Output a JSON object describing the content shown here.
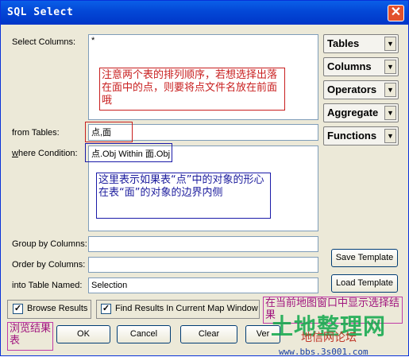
{
  "window": {
    "title": "SQL Select"
  },
  "labels": {
    "select_columns": "Select Columns:",
    "from_tables": "from Tables:",
    "where_condition": "where Condition:",
    "group_by": "Group by Columns:",
    "order_by": "Order by Columns:",
    "into_table": "into Table Named:"
  },
  "fields": {
    "select_columns": "*",
    "from_tables": "点,面",
    "where_condition": "点.Obj Within 面.Obj",
    "group_by": "",
    "order_by": "",
    "into_table": "Selection"
  },
  "side_buttons": [
    "Tables",
    "Columns",
    "Operators",
    "Aggregate",
    "Functions"
  ],
  "buttons": {
    "save_template": "Save Template",
    "load_template": "Load Template",
    "ok": "OK",
    "cancel": "Cancel",
    "clear": "Clear",
    "verify": "Ver"
  },
  "checkboxes": {
    "browse_results": "Browse Results",
    "find_results": "Find Results In Current Map Window"
  },
  "annotations": {
    "order_note": "注意两个表的排列顺序，若想选择出落在面中的点，则要将点文件名放在前面哦",
    "within_note": "这里表示如果表“点”中的对象的形心在表“面”的对象的边界内侧",
    "map_window_note": "在当前地图窗口中显示选择结果",
    "browse_note": "浏览结果表"
  },
  "watermark": {
    "main": "土地整理网",
    "sub": "地信网论坛",
    "url": "www.bbs.3s001.com"
  }
}
